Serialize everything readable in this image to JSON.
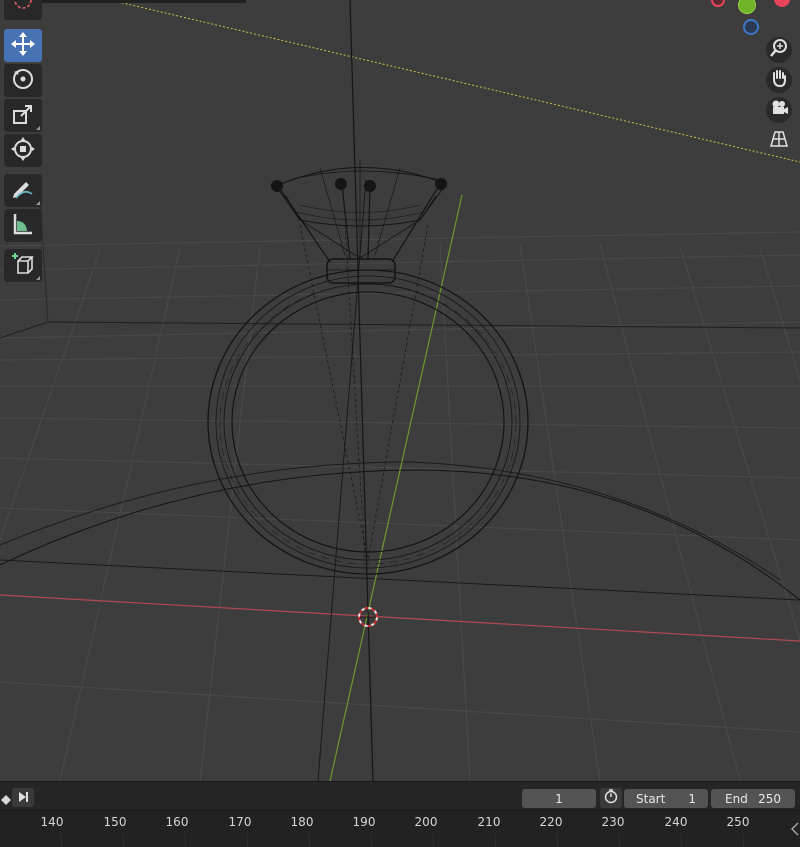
{
  "toolbar": {
    "tools": [
      {
        "name": "cursor",
        "icon": "cursor-icon",
        "active": false
      },
      {
        "name": "move",
        "icon": "move-arrows-icon",
        "active": true
      },
      {
        "name": "rotate",
        "icon": "rotate-icon",
        "active": false
      },
      {
        "name": "scale",
        "icon": "scale-icon",
        "active": false
      },
      {
        "name": "transform",
        "icon": "transform-icon",
        "active": false
      },
      {
        "name": "annotate",
        "icon": "annotate-pencil-icon",
        "active": false
      },
      {
        "name": "measure",
        "icon": "ruler-icon",
        "active": false
      },
      {
        "name": "add-cube",
        "icon": "add-cube-icon",
        "active": false
      }
    ]
  },
  "nav_gizmo": {
    "x_color": "#e8455a",
    "y_color": "#6fb327",
    "z_color": "#3d78c9",
    "buttons": [
      "zoom-icon",
      "hand-pan-icon",
      "camera-icon",
      "perspective-grid-icon"
    ]
  },
  "colors": {
    "viewport_bg": "#3d3d3d",
    "grid": "#4c4c4c",
    "x_axis": "#b34850",
    "y_axis": "#6b9a2c",
    "wireframe": "#141414",
    "selection_line": "#c8c24a",
    "accent": "#4772b3"
  },
  "timeline": {
    "current_frame": "1",
    "start_label": "Start",
    "start_value": "1",
    "end_label": "End",
    "end_value": "250",
    "ruler_ticks": [
      "140",
      "150",
      "160",
      "170",
      "180",
      "190",
      "200",
      "210",
      "220",
      "230",
      "240",
      "250"
    ]
  }
}
